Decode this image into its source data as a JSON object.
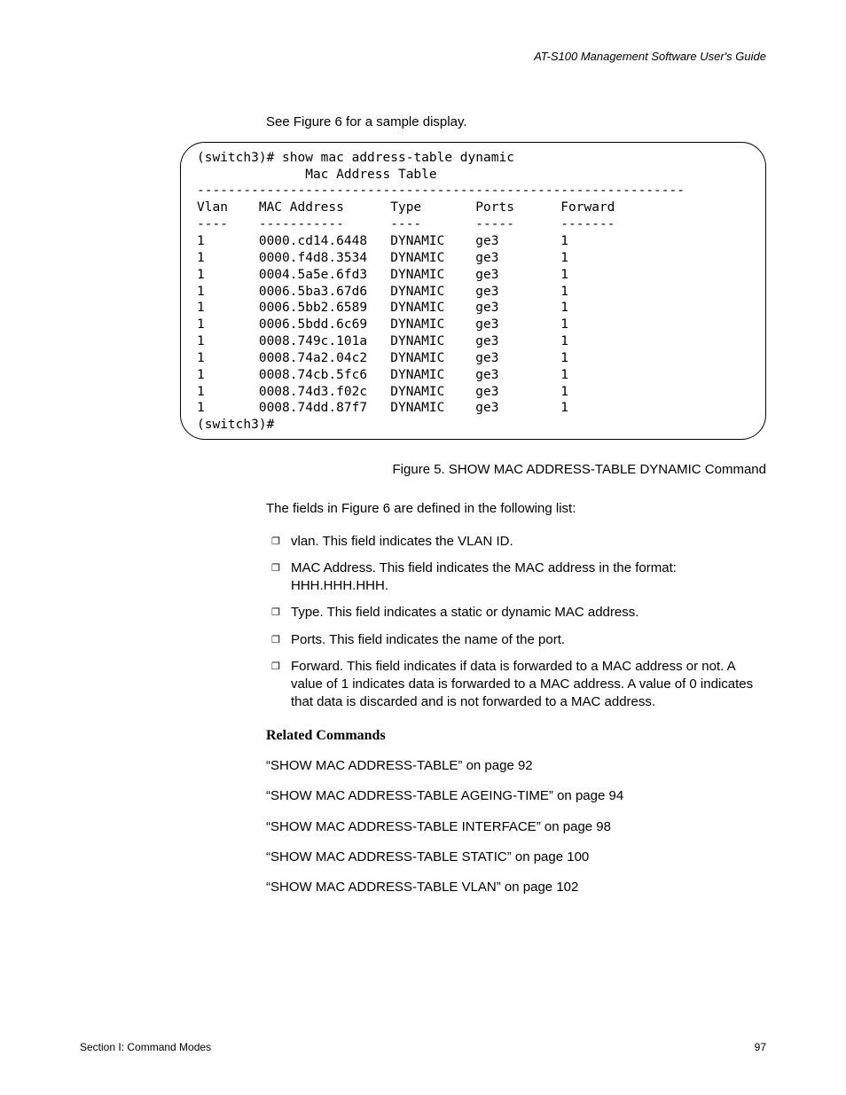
{
  "header": {
    "guideTitle": "AT-S100 Management Software User's Guide"
  },
  "intro": "See Figure 6 for a sample display.",
  "terminal": {
    "promptLine": "(switch3)# show mac address-table dynamic",
    "titleLine": "              Mac Address Table",
    "divider": "---------------------------------------------------------------",
    "headerRow": "Vlan    MAC Address      Type       Ports      Forward",
    "headerUnd": "----    -----------      ----       -----      -------",
    "rows": [
      "1       0000.cd14.6448   DYNAMIC    ge3        1",
      "1       0000.f4d8.3534   DYNAMIC    ge3        1",
      "1       0004.5a5e.6fd3   DYNAMIC    ge3        1",
      "1       0006.5ba3.67d6   DYNAMIC    ge3        1",
      "1       0006.5bb2.6589   DYNAMIC    ge3        1",
      "1       0006.5bdd.6c69   DYNAMIC    ge3        1",
      "1       0008.749c.101a   DYNAMIC    ge3        1",
      "1       0008.74a2.04c2   DYNAMIC    ge3        1",
      "1       0008.74cb.5fc6   DYNAMIC    ge3        1",
      "1       0008.74d3.f02c   DYNAMIC    ge3        1",
      "1       0008.74dd.87f7   DYNAMIC    ge3        1"
    ],
    "endPrompt": "(switch3)#"
  },
  "chart_data": {
    "type": "table",
    "title": "Mac Address Table",
    "columns": [
      "Vlan",
      "MAC Address",
      "Type",
      "Ports",
      "Forward"
    ],
    "rows": [
      [
        "1",
        "0000.cd14.6448",
        "DYNAMIC",
        "ge3",
        "1"
      ],
      [
        "1",
        "0000.f4d8.3534",
        "DYNAMIC",
        "ge3",
        "1"
      ],
      [
        "1",
        "0004.5a5e.6fd3",
        "DYNAMIC",
        "ge3",
        "1"
      ],
      [
        "1",
        "0006.5ba3.67d6",
        "DYNAMIC",
        "ge3",
        "1"
      ],
      [
        "1",
        "0006.5bb2.6589",
        "DYNAMIC",
        "ge3",
        "1"
      ],
      [
        "1",
        "0006.5bdd.6c69",
        "DYNAMIC",
        "ge3",
        "1"
      ],
      [
        "1",
        "0008.749c.101a",
        "DYNAMIC",
        "ge3",
        "1"
      ],
      [
        "1",
        "0008.74a2.04c2",
        "DYNAMIC",
        "ge3",
        "1"
      ],
      [
        "1",
        "0008.74cb.5fc6",
        "DYNAMIC",
        "ge3",
        "1"
      ],
      [
        "1",
        "0008.74d3.f02c",
        "DYNAMIC",
        "ge3",
        "1"
      ],
      [
        "1",
        "0008.74dd.87f7",
        "DYNAMIC",
        "ge3",
        "1"
      ]
    ]
  },
  "figureCaption": "Figure 5. SHOW MAC ADDRESS-TABLE DYNAMIC Command",
  "fieldsIntro": "The fields in Figure 6 are defined in the following list:",
  "bullets": [
    "vlan. This field indicates the VLAN ID.",
    "MAC Address. This field indicates the MAC address in the format: HHH.HHH.HHH.",
    "Type. This field indicates a static or dynamic MAC address.",
    "Ports. This field indicates the name of the port.",
    "Forward. This field indicates if data is forwarded to a MAC address or not. A value of 1 indicates data is forwarded to a MAC address. A value of 0 indicates that data is discarded and is not forwarded to a MAC address."
  ],
  "relatedHeading": "Related Commands",
  "related": [
    "“SHOW MAC ADDRESS-TABLE” on page 92",
    "“SHOW MAC ADDRESS-TABLE AGEING-TIME” on page 94",
    "“SHOW MAC ADDRESS-TABLE INTERFACE” on page 98",
    "“SHOW MAC ADDRESS-TABLE STATIC” on page 100",
    "“SHOW MAC ADDRESS-TABLE VLAN” on page 102"
  ],
  "footer": {
    "left": "Section I: Command Modes",
    "right": "97"
  }
}
